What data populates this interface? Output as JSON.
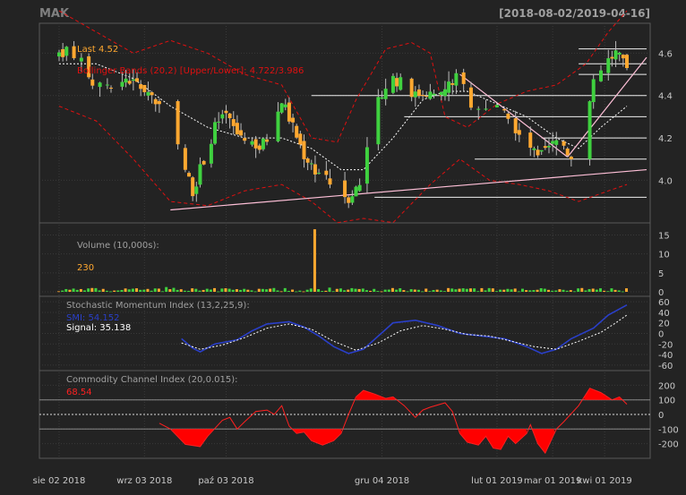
{
  "header": {
    "symbol": "MAK",
    "date_range": "[2018-08-02/2019-04-16]"
  },
  "colors": {
    "background": "#232323",
    "panel_border": "#5a5a5a",
    "grid": "#3a3a3a",
    "up": "#3fd13f",
    "down": "#ffa830",
    "bollinger": "#e01010",
    "ma": "#ffffff",
    "trendline": "#ffc0d8",
    "volume_up": "#3fd13f",
    "volume_down": "#ffa830",
    "smi": "#2a3fc8",
    "signal": "#ffffff",
    "cci_fill": "#ff0000",
    "cci_line": "#ff2020",
    "label": "#a0a0a0",
    "tick": "#c8c8c8"
  },
  "chart_data": [
    {
      "type": "candlestick",
      "panel": "price",
      "annotations": {
        "last": "Last 4.52",
        "bbands": "Bollinger Bands (20,2) [Upper/Lower]: 4.722/3.986"
      },
      "y_ticks": [
        4.0,
        4.2,
        4.4,
        4.6
      ],
      "ylim": [
        3.82,
        4.72
      ],
      "close_path": [
        [
          0,
          4.6
        ],
        [
          3,
          4.62
        ],
        [
          6,
          4.55
        ],
        [
          9,
          4.45
        ],
        [
          12,
          4.48
        ],
        [
          15,
          4.4
        ],
        [
          18,
          4.48
        ],
        [
          21,
          4.45
        ],
        [
          24,
          4.42
        ],
        [
          27,
          4.35
        ],
        [
          30,
          4.25
        ],
        [
          33,
          4.1
        ],
        [
          36,
          3.95
        ],
        [
          39,
          4.1
        ],
        [
          42,
          4.25
        ],
        [
          45,
          4.3
        ],
        [
          48,
          4.22
        ],
        [
          51,
          4.2
        ],
        [
          54,
          4.15
        ],
        [
          57,
          4.22
        ],
        [
          60,
          4.38
        ],
        [
          63,
          4.25
        ],
        [
          66,
          4.12
        ],
        [
          69,
          4.05
        ],
        [
          72,
          4.0
        ],
        [
          75,
          3.95
        ],
        [
          78,
          3.92
        ],
        [
          81,
          3.98
        ],
        [
          84,
          4.25
        ],
        [
          87,
          4.42
        ],
        [
          90,
          4.48
        ],
        [
          93,
          4.45
        ],
        [
          96,
          4.4
        ],
        [
          99,
          4.42
        ],
        [
          102,
          4.38
        ],
        [
          105,
          4.45
        ],
        [
          108,
          4.5
        ],
        [
          111,
          4.35
        ],
        [
          114,
          4.32
        ],
        [
          117,
          4.35
        ],
        [
          120,
          4.3
        ],
        [
          123,
          4.25
        ],
        [
          126,
          4.18
        ],
        [
          129,
          4.1
        ],
        [
          132,
          4.15
        ],
        [
          135,
          4.2
        ],
        [
          138,
          4.1
        ],
        [
          141,
          4.25
        ],
        [
          144,
          4.45
        ],
        [
          147,
          4.55
        ],
        [
          150,
          4.6
        ],
        [
          153,
          4.52
        ]
      ],
      "upper_band": [
        [
          0,
          4.8
        ],
        [
          10,
          4.7
        ],
        [
          20,
          4.6
        ],
        [
          30,
          4.66
        ],
        [
          40,
          4.6
        ],
        [
          50,
          4.5
        ],
        [
          60,
          4.45
        ],
        [
          68,
          4.2
        ],
        [
          75,
          4.18
        ],
        [
          80,
          4.38
        ],
        [
          88,
          4.62
        ],
        [
          95,
          4.65
        ],
        [
          100,
          4.6
        ],
        [
          104,
          4.3
        ],
        [
          110,
          4.25
        ],
        [
          118,
          4.36
        ],
        [
          126,
          4.42
        ],
        [
          134,
          4.45
        ],
        [
          142,
          4.55
        ],
        [
          148,
          4.7
        ],
        [
          153,
          4.8
        ]
      ],
      "lower_band": [
        [
          0,
          4.35
        ],
        [
          10,
          4.28
        ],
        [
          20,
          4.1
        ],
        [
          30,
          3.9
        ],
        [
          40,
          3.88
        ],
        [
          50,
          3.95
        ],
        [
          60,
          3.98
        ],
        [
          68,
          3.9
        ],
        [
          75,
          3.8
        ],
        [
          82,
          3.82
        ],
        [
          90,
          3.8
        ],
        [
          100,
          3.98
        ],
        [
          108,
          4.1
        ],
        [
          116,
          4.0
        ],
        [
          124,
          3.98
        ],
        [
          132,
          3.95
        ],
        [
          140,
          3.9
        ],
        [
          148,
          3.95
        ],
        [
          153,
          3.98
        ]
      ],
      "ma_path": [
        [
          0,
          4.55
        ],
        [
          10,
          4.55
        ],
        [
          20,
          4.48
        ],
        [
          30,
          4.35
        ],
        [
          40,
          4.25
        ],
        [
          50,
          4.2
        ],
        [
          60,
          4.2
        ],
        [
          68,
          4.15
        ],
        [
          76,
          4.05
        ],
        [
          82,
          4.05
        ],
        [
          90,
          4.2
        ],
        [
          98,
          4.38
        ],
        [
          104,
          4.42
        ],
        [
          110,
          4.42
        ],
        [
          118,
          4.36
        ],
        [
          126,
          4.3
        ],
        [
          134,
          4.2
        ],
        [
          140,
          4.15
        ],
        [
          146,
          4.25
        ],
        [
          153,
          4.35
        ]
      ],
      "resistance_levels": [
        4.62,
        4.55,
        4.5,
        4.4,
        4.3,
        4.2,
        4.1,
        3.92
      ],
      "trendlines": [
        [
          [
            30,
            3.86
          ],
          [
            153,
            4.05
          ]
        ],
        [
          [
            108,
            4.5
          ],
          [
            137,
            4.11
          ]
        ],
        [
          [
            137,
            4.11
          ],
          [
            153,
            4.58
          ]
        ]
      ]
    },
    {
      "type": "bar",
      "panel": "volume",
      "title": "Volume (10,000s):",
      "last_value": "230",
      "y_ticks": [
        0,
        5,
        10,
        15
      ],
      "ylim": [
        0,
        17
      ],
      "peak": {
        "index": 69,
        "value": 16.5
      }
    },
    {
      "type": "line",
      "panel": "smi",
      "title": "Stochastic Momentum Index (13,2,25,9):",
      "smi_label": "SMI: 54.152",
      "signal_label": "Signal: 35.138",
      "y_ticks": [
        -60,
        -40,
        -20,
        0,
        20,
        40,
        60
      ],
      "ylim": [
        -62,
        62
      ],
      "start_index": 33,
      "smi": [
        [
          33,
          -10
        ],
        [
          36,
          -28
        ],
        [
          38,
          -35
        ],
        [
          42,
          -20
        ],
        [
          48,
          -12
        ],
        [
          52,
          5
        ],
        [
          56,
          18
        ],
        [
          62,
          22
        ],
        [
          66,
          12
        ],
        [
          70,
          -5
        ],
        [
          74,
          -25
        ],
        [
          78,
          -38
        ],
        [
          82,
          -30
        ],
        [
          86,
          -5
        ],
        [
          90,
          20
        ],
        [
          96,
          25
        ],
        [
          102,
          15
        ],
        [
          108,
          0
        ],
        [
          114,
          -5
        ],
        [
          120,
          -10
        ],
        [
          126,
          -25
        ],
        [
          130,
          -38
        ],
        [
          134,
          -30
        ],
        [
          138,
          -10
        ],
        [
          144,
          10
        ],
        [
          148,
          35
        ],
        [
          153,
          54
        ]
      ],
      "signal": [
        [
          33,
          -18
        ],
        [
          38,
          -30
        ],
        [
          44,
          -22
        ],
        [
          50,
          -8
        ],
        [
          56,
          10
        ],
        [
          62,
          18
        ],
        [
          68,
          8
        ],
        [
          74,
          -15
        ],
        [
          80,
          -32
        ],
        [
          86,
          -18
        ],
        [
          92,
          5
        ],
        [
          98,
          15
        ],
        [
          104,
          8
        ],
        [
          110,
          -2
        ],
        [
          116,
          -5
        ],
        [
          122,
          -15
        ],
        [
          128,
          -25
        ],
        [
          134,
          -30
        ],
        [
          140,
          -15
        ],
        [
          146,
          2
        ],
        [
          150,
          20
        ],
        [
          153,
          35
        ]
      ]
    },
    {
      "type": "area",
      "panel": "cci",
      "title": "Commodity Channel Index (20,0.015):",
      "last_value": "68.54",
      "y_ticks": [
        -200,
        -100,
        0,
        100,
        200
      ],
      "ylim": [
        -270,
        270
      ],
      "start_index": 27,
      "cci": [
        [
          27,
          -60
        ],
        [
          30,
          -100
        ],
        [
          34,
          -205
        ],
        [
          38,
          -220
        ],
        [
          40,
          -150
        ],
        [
          44,
          -40
        ],
        [
          46,
          -20
        ],
        [
          48,
          -100
        ],
        [
          50,
          -50
        ],
        [
          53,
          20
        ],
        [
          56,
          30
        ],
        [
          58,
          0
        ],
        [
          60,
          60
        ],
        [
          62,
          -80
        ],
        [
          64,
          -130
        ],
        [
          66,
          -120
        ],
        [
          68,
          -180
        ],
        [
          71,
          -210
        ],
        [
          74,
          -180
        ],
        [
          76,
          -130
        ],
        [
          78,
          0
        ],
        [
          80,
          120
        ],
        [
          82,
          165
        ],
        [
          85,
          140
        ],
        [
          88,
          110
        ],
        [
          90,
          120
        ],
        [
          93,
          60
        ],
        [
          96,
          -20
        ],
        [
          98,
          30
        ],
        [
          100,
          50
        ],
        [
          104,
          80
        ],
        [
          106,
          20
        ],
        [
          108,
          -130
        ],
        [
          110,
          -190
        ],
        [
          113,
          -210
        ],
        [
          115,
          -150
        ],
        [
          117,
          -230
        ],
        [
          119,
          -240
        ],
        [
          121,
          -150
        ],
        [
          123,
          -200
        ],
        [
          126,
          -130
        ],
        [
          127,
          -70
        ],
        [
          129,
          -200
        ],
        [
          131,
          -265
        ],
        [
          134,
          -100
        ],
        [
          136,
          -50
        ],
        [
          140,
          60
        ],
        [
          143,
          180
        ],
        [
          146,
          150
        ],
        [
          149,
          100
        ],
        [
          151,
          120
        ],
        [
          153,
          70
        ]
      ]
    }
  ],
  "x_axis": {
    "labels": [
      {
        "text": "sie 02 2018",
        "index": 0
      },
      {
        "text": "wrz 03 2018",
        "index": 23
      },
      {
        "text": "paź 03 2018",
        "index": 45
      },
      {
        "text": "gru 04 2018",
        "index": 87
      },
      {
        "text": "lut 01 2019",
        "index": 118
      },
      {
        "text": "mar 01 2019",
        "index": 133
      },
      {
        "text": "kwi 01 2019",
        "index": 147
      }
    ]
  }
}
